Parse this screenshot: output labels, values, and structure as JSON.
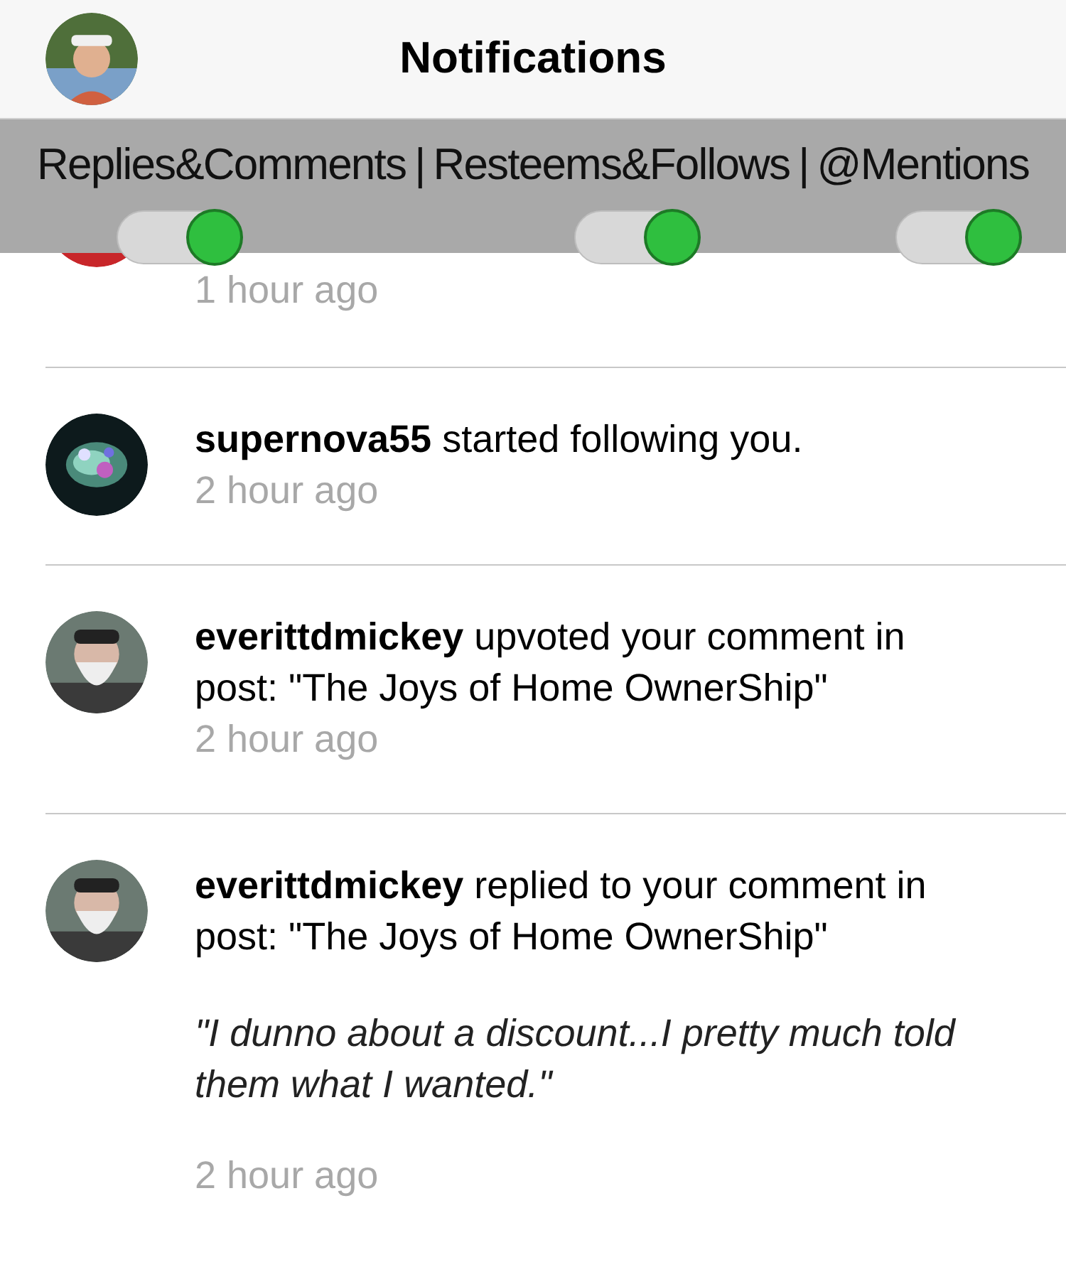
{
  "header": {
    "title": "Notifications"
  },
  "filter_bar": {
    "filters": [
      {
        "label": "Replies&Comments",
        "on": true
      },
      {
        "label": "Resteems&Follows",
        "on": true
      },
      {
        "label": "@Mentions",
        "on": true
      }
    ],
    "separators": [
      "|",
      "|"
    ]
  },
  "notifications": [
    {
      "time": "1 hour ago"
    },
    {
      "message": "**supernova55** started following you.",
      "time": "2 hour ago"
    },
    {
      "message": "**everittdmickey** upvoted your comment in post: \"The Joys of Home OwnerShip\"",
      "time": "2 hour ago"
    },
    {
      "message": "**everittdmickey** replied to your comment in post: \"The Joys of Home OwnerShip\"",
      "quote": "\"I dunno about a discount...I pretty much told them what I wanted.\"",
      "time": "2 hour ago"
    }
  ]
}
